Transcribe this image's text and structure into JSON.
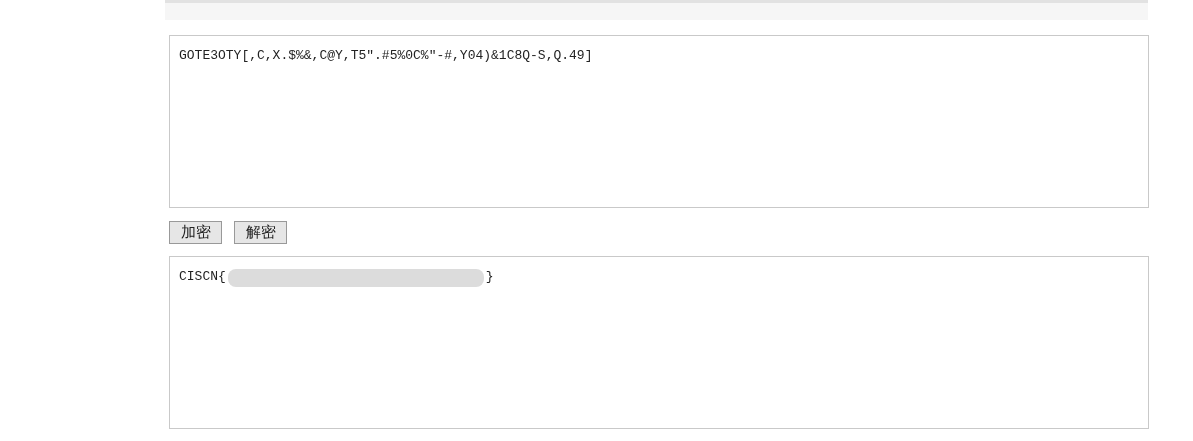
{
  "input": {
    "value": "GOTE3OTY[,C,X.$%&,C@Y,T5\".#5%0C%\"-#,Y04)&1C8Q-S,Q.49]"
  },
  "buttons": [
    {
      "label": "加密"
    },
    {
      "label": "解密"
    }
  ],
  "output": {
    "prefix": "CISCN{",
    "redacted": true,
    "suffix": "}"
  }
}
